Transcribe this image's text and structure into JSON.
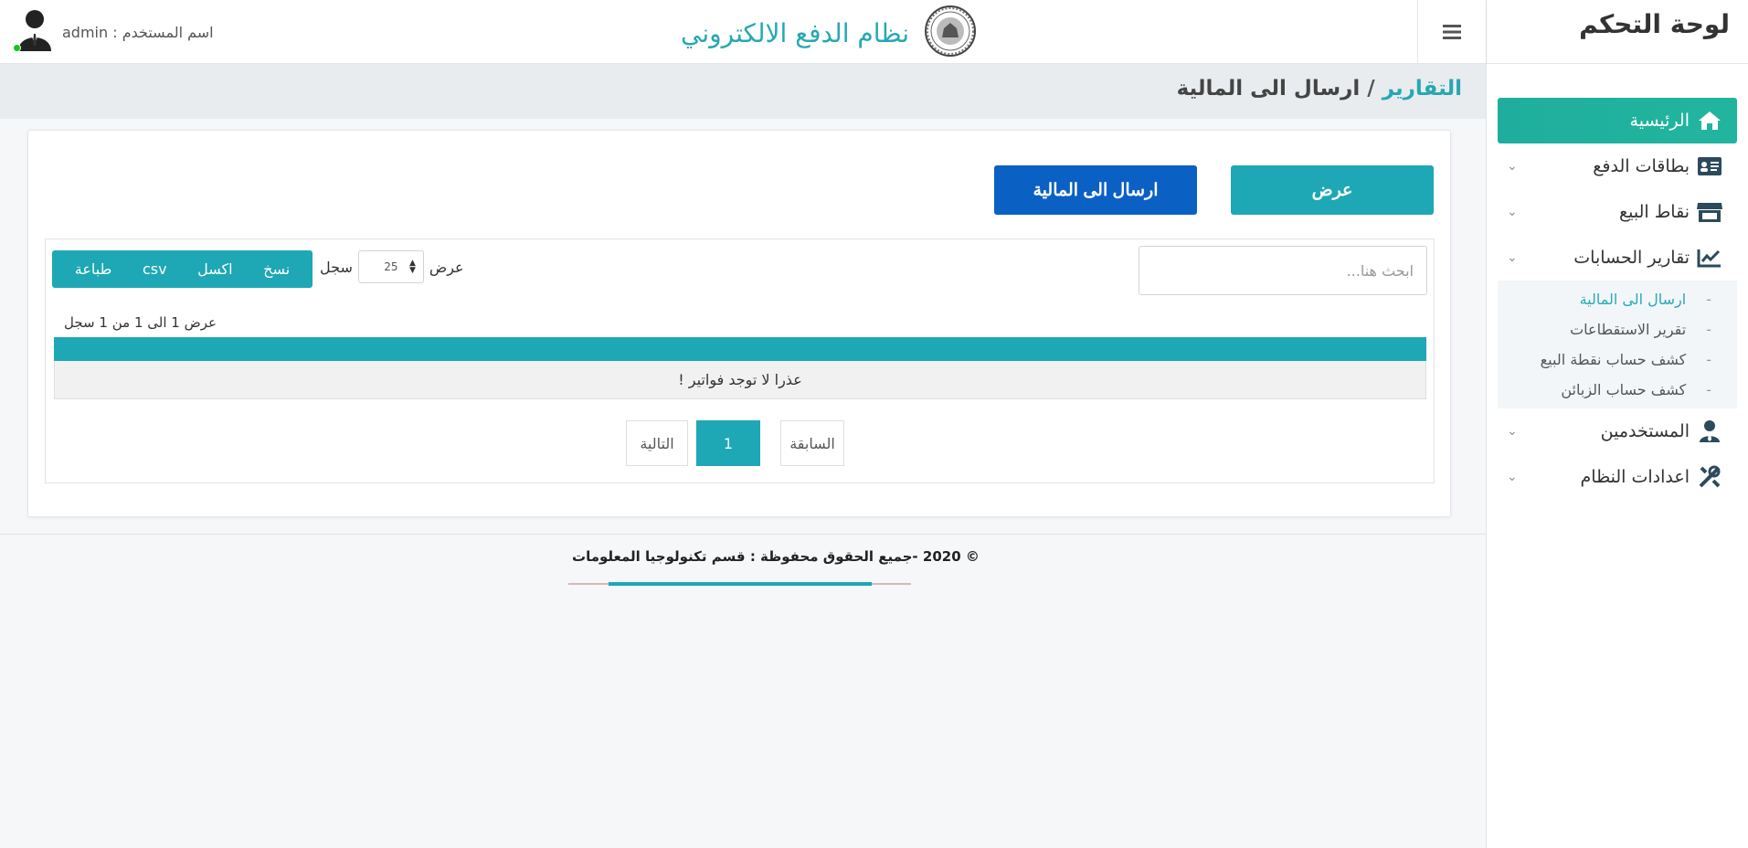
{
  "colors": {
    "accent": "#1ea7b5",
    "active_menu": "#22b59e",
    "send_button": "#0b60c4",
    "online": "#17c21d"
  },
  "header": {
    "brand_title": "نظام الدفع الالكتروني",
    "user_label": "اسم المستخدم : admin",
    "menu_icon": "hamburger-icon",
    "logo": "seal-logo"
  },
  "sidebar": {
    "title": "لوحة التحكم",
    "items": [
      {
        "label": "الرئيسية",
        "icon": "home-icon"
      },
      {
        "label": "بطاقات الدفع",
        "icon": "id-card-icon"
      },
      {
        "label": "نقاط البيع",
        "icon": "store-icon"
      },
      {
        "label": "تقارير الحسابات",
        "icon": "chart-line-icon"
      },
      {
        "label": "المستخدمين",
        "icon": "user-tie-icon"
      },
      {
        "label": "اعدادات النظام",
        "icon": "tools-icon"
      }
    ],
    "subitems": [
      {
        "label": "ارسال الى المالية"
      },
      {
        "label": "تقرير الاستقطاعات"
      },
      {
        "label": "كشف حساب نقطة البيع"
      },
      {
        "label": "كشف حساب الزبائن"
      }
    ],
    "sub_dash": "-"
  },
  "breadcrumb": {
    "root": "التقارير",
    "separator": "/",
    "current": "ارسال الى المالية"
  },
  "actions": {
    "show_label": "عرض",
    "send_label": "ارسال الى المالية"
  },
  "table": {
    "search_placeholder": "ابحث هنا...",
    "length_prefix": "عرض",
    "length_value": "25",
    "length_suffix": "سجل",
    "export_buttons": [
      "نسخ",
      "اكسل",
      "csv",
      "طباعة"
    ],
    "info": "عرض 1 الى 1 من 1 سجل",
    "empty_message": "عذرا لا توجد فواتير !",
    "pagination": {
      "prev": "السابقة",
      "current": "1",
      "next": "التالية"
    }
  },
  "footer": {
    "text": "© 2020 -جميع الحقوق محفوظة : قسم تكنولوجيا المعلومات"
  }
}
